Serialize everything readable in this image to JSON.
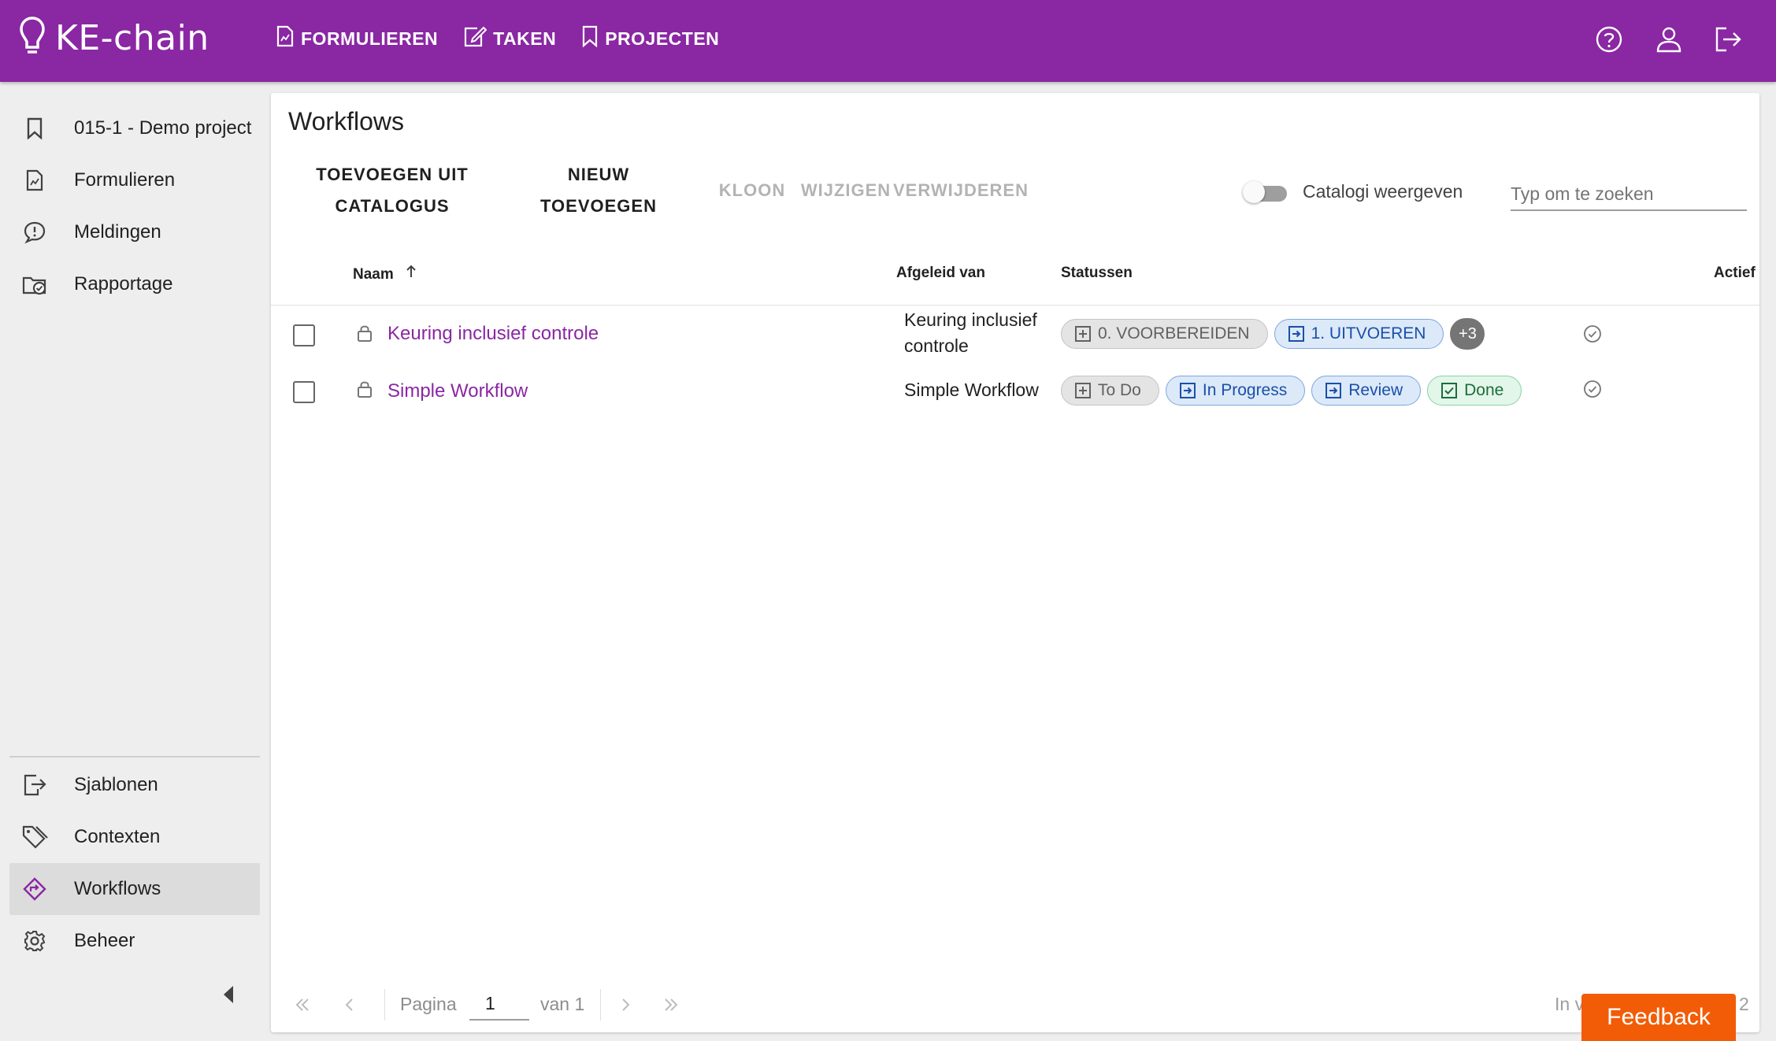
{
  "app": {
    "name": "KE-chain"
  },
  "topnav": [
    {
      "label": "FORMULIEREN",
      "icon": "form-icon"
    },
    {
      "label": "TAKEN",
      "icon": "edit-icon"
    },
    {
      "label": "PROJECTEN",
      "icon": "bookmark-icon"
    }
  ],
  "topright": {
    "help_icon": "help-circle-icon",
    "user_icon": "user-icon",
    "logout_icon": "logout-icon"
  },
  "sidebar": {
    "items": [
      {
        "label": "015-1 - Demo project",
        "icon": "bookmark-icon"
      },
      {
        "label": "Formulieren",
        "icon": "form-icon"
      },
      {
        "label": "Meldingen",
        "icon": "message-alert-icon"
      },
      {
        "label": "Rapportage",
        "icon": "report-icon"
      }
    ],
    "bottom_items": [
      {
        "label": "Sjablonen",
        "icon": "template-export-icon"
      },
      {
        "label": "Contexten",
        "icon": "tags-icon"
      },
      {
        "label": "Workflows",
        "icon": "workflow-icon",
        "active": true
      },
      {
        "label": "Beheer",
        "icon": "gear-icon"
      }
    ]
  },
  "page": {
    "title": "Workflows",
    "toolbar": {
      "add_from_catalog_line1": "TOEVOEGEN UIT",
      "add_from_catalog_line2": "CATALOGUS",
      "new_line1": "NIEUW",
      "new_line2": "TOEVOEGEN",
      "clone": "KLOON",
      "edit": "WIJZIGEN",
      "delete": "VERWIJDEREN"
    },
    "catalog_toggle": {
      "label": "Catalogi weergeven",
      "on": false
    },
    "search": {
      "placeholder": "Typ om te zoeken",
      "value": ""
    },
    "columns": {
      "name": "Naam",
      "derived": "Afgeleid van",
      "statuses": "Statussen",
      "active": "Actief"
    },
    "rows": [
      {
        "name": "Keuring inclusief controle",
        "derived_line1": "Keuring inclusief",
        "derived_line2": "controle",
        "statuses": [
          {
            "label": "0. VOORBEREIDEN",
            "kind": "grey"
          },
          {
            "label": "1. UITVOEREN",
            "kind": "blue"
          }
        ],
        "more": "+3",
        "active": true
      },
      {
        "name": "Simple Workflow",
        "derived_line1": "Simple Workflow",
        "derived_line2": "",
        "statuses": [
          {
            "label": "To Do",
            "kind": "grey"
          },
          {
            "label": "In Progress",
            "kind": "blue"
          },
          {
            "label": "Review",
            "kind": "blue"
          },
          {
            "label": "Done",
            "kind": "green"
          }
        ],
        "more": "",
        "active": true
      }
    ],
    "pagination": {
      "page_label": "Pagina",
      "page": "1",
      "of_label": "van 1",
      "right_text": "In v",
      "right_count": "2"
    }
  },
  "feedback": {
    "label": "Feedback"
  },
  "colors": {
    "brand": "#8a27a3",
    "feedback": "#f25c07"
  }
}
